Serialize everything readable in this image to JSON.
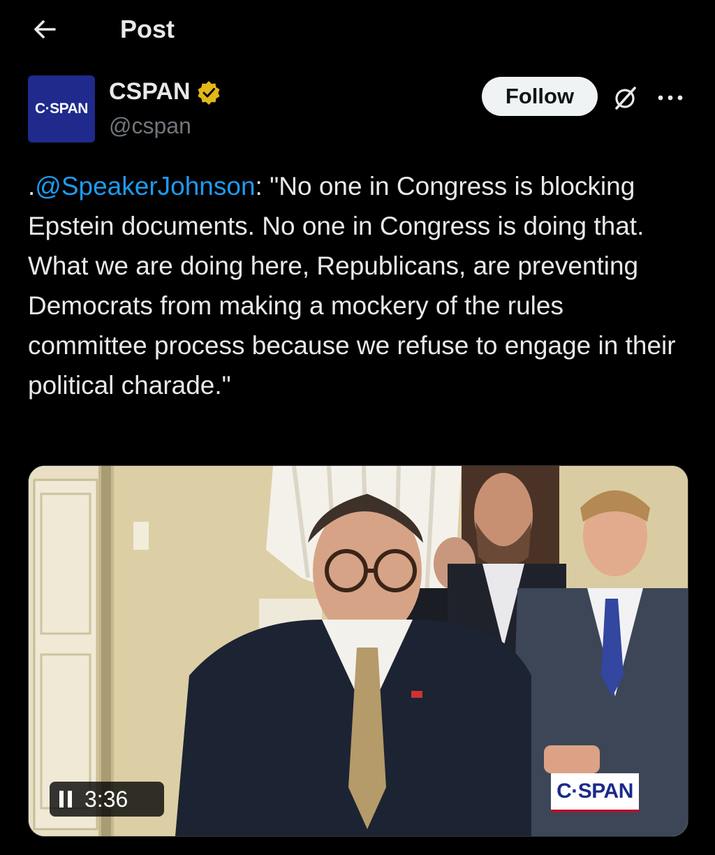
{
  "header": {
    "title": "Post"
  },
  "author": {
    "avatar_text": "C·SPAN",
    "display_name": "CSPAN",
    "handle": "@cspan",
    "verified": true,
    "follow_label": "Follow"
  },
  "post": {
    "prefix": ".",
    "mention": "@SpeakerJohnson",
    "body": ": \"No one in Congress is blocking Epstein documents. No one in Congress is doing that. What we are doing here, Republicans, are preventing Democrats from making a mockery of the rules committee process because we refuse to engage in their political charade.\""
  },
  "video": {
    "time": "3:36",
    "state": "playing",
    "watermark": "C·SPAN"
  },
  "colors": {
    "link": "#1d9bf0",
    "verified_badge": "#e2b719",
    "avatar_bg": "#1f2a8c",
    "watermark_stripe": "#b3122d"
  },
  "icons": [
    "back-arrow-icon",
    "verified-badge-icon",
    "grok-icon",
    "more-options-icon",
    "pause-icon"
  ]
}
